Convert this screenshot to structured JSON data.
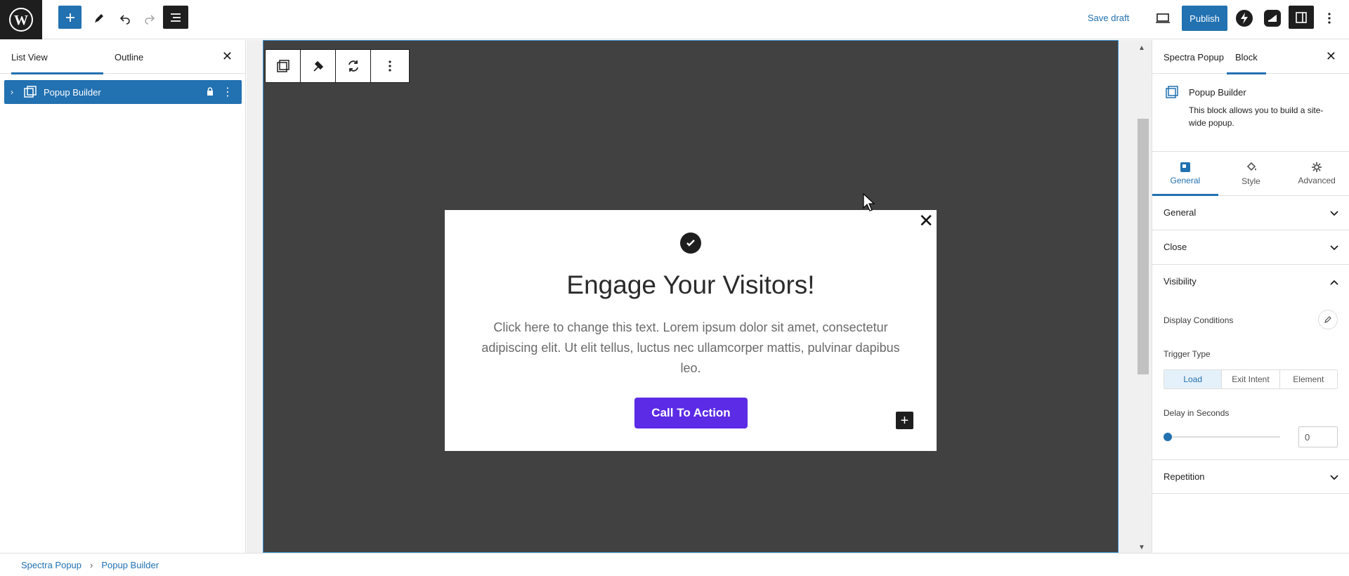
{
  "topbar": {
    "save_draft": "Save draft",
    "publish": "Publish"
  },
  "left_panel": {
    "tabs": [
      "List View",
      "Outline"
    ],
    "item_label": "Popup Builder"
  },
  "popup": {
    "title": "Engage Your Visitors!",
    "text": "Click here to change this text. Lorem ipsum dolor sit amet, consectetur adipiscing elit. Ut elit tellus, luctus nec ullamcorper mattis, pulvinar dapibus leo.",
    "cta": "Call To Action"
  },
  "right_panel": {
    "tabs": [
      "Spectra Popup",
      "Block"
    ],
    "block_title": "Popup Builder",
    "block_desc": "This block allows you to build a site-wide popup.",
    "inner_tabs": [
      "General",
      "Style",
      "Advanced"
    ],
    "sections": {
      "general": "General",
      "close": "Close",
      "visibility": "Visibility",
      "repetition": "Repetition"
    },
    "display_conditions": "Display Conditions",
    "trigger_type": "Trigger Type",
    "trigger_options": [
      "Load",
      "Exit Intent",
      "Element"
    ],
    "delay_label": "Delay in Seconds",
    "delay_value": "0"
  },
  "breadcrumb": [
    "Spectra Popup",
    "Popup Builder"
  ],
  "colors": {
    "accent": "#2271b1",
    "cta": "#5b2be6",
    "canvas": "#414141"
  }
}
